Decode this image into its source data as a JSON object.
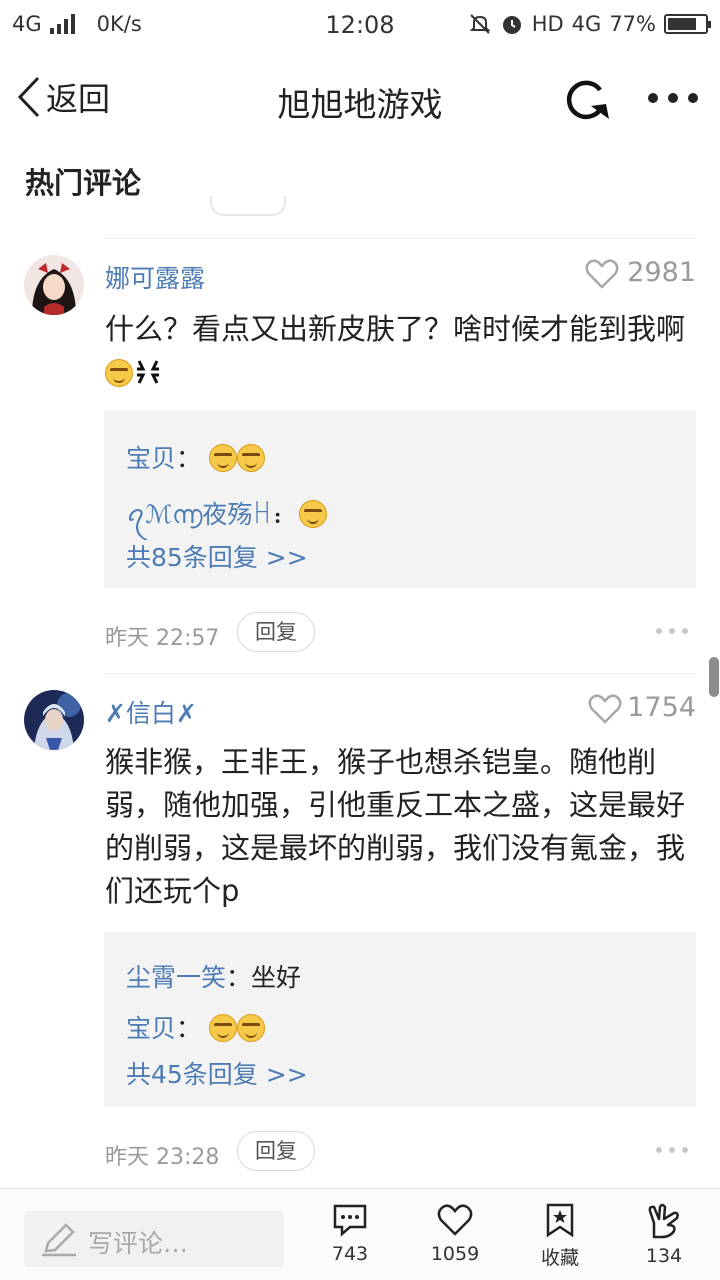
{
  "status_bar": {
    "network_left": "4G",
    "speed": "0K/s",
    "time": "12:08",
    "hd": "HD",
    "network_right": "4G",
    "battery": "77%",
    "battery_level": 0.77
  },
  "nav": {
    "back_label": "返回",
    "title": "旭旭地游戏"
  },
  "section_title": "热门评论",
  "comments": [
    {
      "user": "娜可露露",
      "likes": "2981",
      "text": "什么？看点又出新皮肤了？啥时候才能到我啊",
      "replies": [
        {
          "user": "宝贝",
          "sep": "：",
          "text": ""
        },
        {
          "user": "ꪖℳ൬夜殇ꀿ",
          "sep": "：",
          "text": ""
        }
      ],
      "more_replies": "共85条回复 >>",
      "time": "昨天 22:57",
      "reply_label": "回复"
    },
    {
      "user": "✗信白✗",
      "likes": "1754",
      "text": "猴非猴，王非王，猴子也想杀铠皇。随他削弱，随他加强，引他重反工本之盛，这是最好的削弱，这是最坏的削弱，我们没有氪金，我们还玩个p",
      "replies": [
        {
          "user": "尘霄一笑",
          "sep": "：",
          "text": "坐好"
        },
        {
          "user": "宝贝",
          "sep": "：",
          "text": ""
        }
      ],
      "more_replies": "共45条回复 >>",
      "time": "昨天 23:28",
      "reply_label": "回复"
    }
  ],
  "bottom_bar": {
    "write_placeholder": "写评论…",
    "comments_count": "743",
    "likes_count": "1059",
    "favorite_label": "收藏",
    "share_count": "134"
  },
  "colors": {
    "link_blue": "#4d7cb5",
    "muted_gray": "#9a9a9a",
    "reply_bg": "#f3f3f3"
  }
}
